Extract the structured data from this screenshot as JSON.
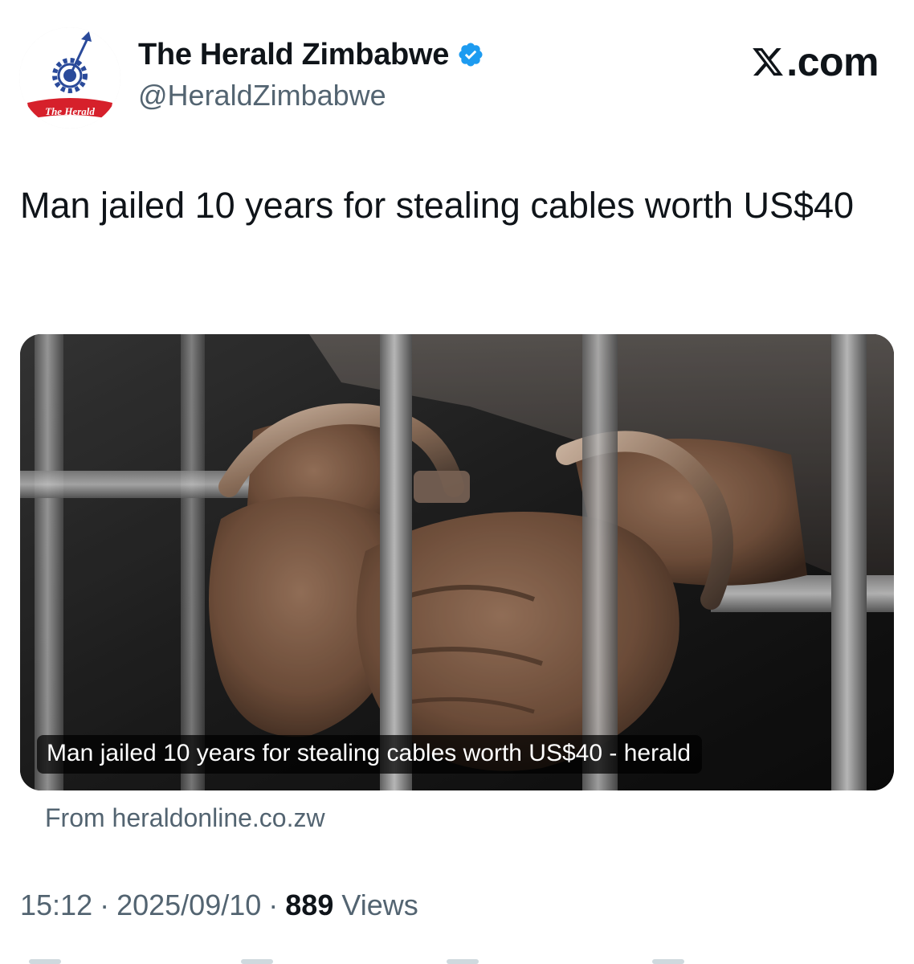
{
  "account": {
    "display_name": "The Herald Zimbabwe",
    "handle": "@HeraldZimbabwe",
    "verified": true,
    "avatar_logo_text": "The Herald"
  },
  "brand": {
    "text": ".com",
    "icon": "x-logo-icon"
  },
  "tweet": {
    "text": "Man jailed 10 years for stealing cables worth US$40"
  },
  "link_card": {
    "image_icon": "handcuffed-hands-behind-bars-photo",
    "caption": "Man jailed 10 years for stealing cables worth US$40 - herald",
    "source": "From heraldonline.co.zw"
  },
  "meta": {
    "time": "15:12",
    "separator": "·",
    "date": "2025/09/10",
    "views_count": "889",
    "views_label": "Views"
  },
  "colors": {
    "text_primary": "#0f1419",
    "text_secondary": "#536471",
    "verified_blue": "#1d9bf0",
    "logo_red": "#d6202b",
    "logo_blue": "#2a4a9a"
  }
}
